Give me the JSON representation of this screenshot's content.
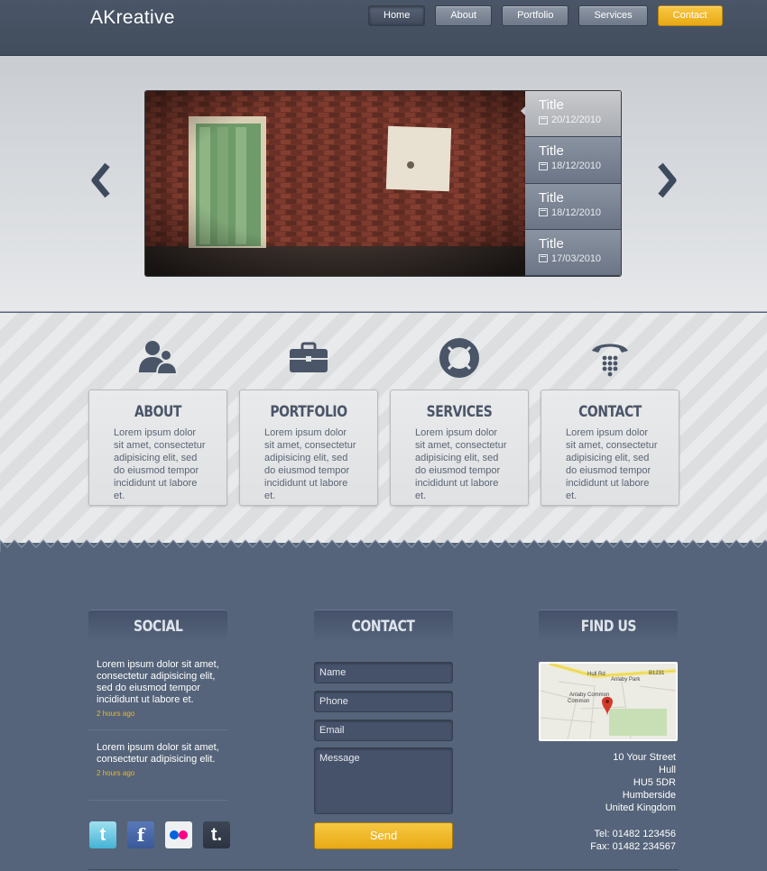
{
  "header": {
    "logo": "AKreative",
    "nav": [
      "Home",
      "About",
      "Portfolio",
      "Services",
      "Contact"
    ]
  },
  "slider": {
    "items": [
      {
        "title": "Title",
        "date": "20/12/2010"
      },
      {
        "title": "Title",
        "date": "18/12/2010"
      },
      {
        "title": "Title",
        "date": "18/12/2010"
      },
      {
        "title": "Title",
        "date": "17/03/2010"
      }
    ],
    "prev_icon": "chevron-left-icon",
    "next_icon": "chevron-right-icon"
  },
  "features": [
    {
      "title": "ABOUT",
      "icon": "users-icon",
      "text": "Lorem ipsum dolor sit amet, consectetur adipisicing elit, sed do eiusmod tempor incididunt ut labore et."
    },
    {
      "title": "PORTFOLIO",
      "icon": "briefcase-icon",
      "text": "Lorem ipsum dolor sit amet, consectetur adipisicing elit, sed do eiusmod tempor incididunt ut labore et."
    },
    {
      "title": "SERVICES",
      "icon": "lifebuoy-icon",
      "text": "Lorem ipsum dolor sit amet, consectetur adipisicing elit, sed do eiusmod tempor incididunt ut labore et."
    },
    {
      "title": "CONTACT",
      "icon": "telephone-icon",
      "text": "Lorem ipsum dolor sit amet, consectetur adipisicing elit, sed do eiusmod tempor incididunt ut labore et."
    }
  ],
  "footer": {
    "social": {
      "heading": "SOCIAL",
      "tweets": [
        {
          "text": "Lorem ipsum dolor sit amet, consectetur adipisicing elit, sed do eiusmod tempor incididunt ut labore et.",
          "ago": "2 hours ago"
        },
        {
          "text": "Lorem ipsum dolor sit amet, consectetur adipisicing elit.",
          "ago": "2 hours ago"
        }
      ],
      "icons": [
        "twitter-icon",
        "facebook-icon",
        "flickr-icon",
        "tumblr-icon"
      ]
    },
    "contact": {
      "heading": "CONTACT",
      "name_placeholder": "Name",
      "phone_placeholder": "Phone",
      "email_placeholder": "Email",
      "message_placeholder": "Message",
      "send_label": "Send"
    },
    "find_us": {
      "heading": "FIND US",
      "map_labels": [
        "Hull Rd",
        "Anlaby Park",
        "B1231",
        "Anlaby Common"
      ],
      "address": [
        "10 Your Street",
        "Hull",
        "HU5 5DR",
        "Humberside",
        "United Kingdom"
      ],
      "tel": "Tel: 01482 123456",
      "fax": "Fax: 01482 234567"
    }
  },
  "colors": {
    "accent": "#f0b626",
    "footer_bg": "#55647a",
    "header_bg": "#444f60"
  }
}
